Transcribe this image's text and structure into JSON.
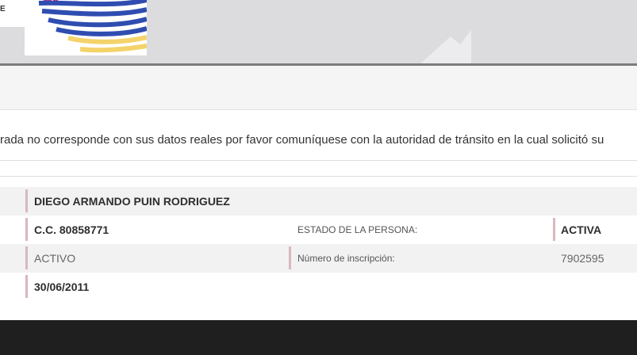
{
  "header": {
    "logo_text": "E"
  },
  "notice": {
    "text": "rada no corresponde con sus datos reales por favor comuníquese con la autoridad de tránsito en la cual solicitó su"
  },
  "person": {
    "name": "DIEGO ARMANDO PUIN RODRIGUEZ",
    "document": "C.C. 80858771",
    "estado_label": "ESTADO DE LA PERSONA:",
    "estado_value": "ACTIVA",
    "status": "ACTIVO",
    "inscripcion_label": "Número de inscripción:",
    "inscripcion_value": "7902595",
    "date": "30/06/2011"
  },
  "colors": {
    "header_bg": "#dcdcde",
    "accent_bar": "#d9b8bd",
    "footer_bg": "#1f1f1f",
    "logo_blue": "#2f4db0",
    "logo_yellow": "#f3d36a"
  }
}
